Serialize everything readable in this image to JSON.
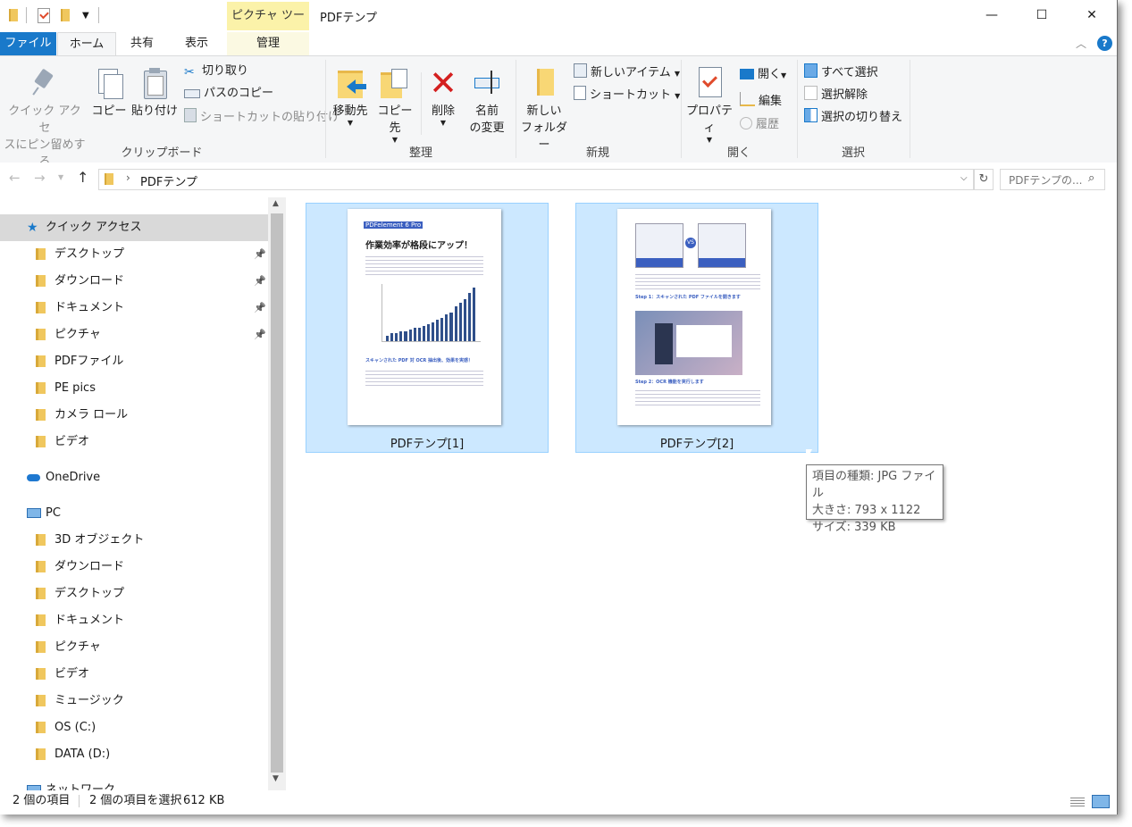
{
  "window": {
    "title": "PDFテンプ",
    "context_tab": "ピクチャ ツール",
    "minimize": "—",
    "maximize": "☐",
    "close": "✕"
  },
  "tabs": {
    "file": "ファイル",
    "home": "ホーム",
    "share": "共有",
    "view": "表示",
    "manage": "管理"
  },
  "ribbon": {
    "clipboard": {
      "label": "クリップボード",
      "pin_quick_line1": "クイック アクセ",
      "pin_quick_line2": "スにピン留めする",
      "copy": "コピー",
      "paste": "貼り付け",
      "cut": "切り取り",
      "copy_path": "パスのコピー",
      "paste_shortcut": "ショートカットの貼り付け"
    },
    "organize": {
      "label": "整理",
      "move_to": "移動先",
      "copy_to": "コピー先",
      "delete": "削除",
      "rename_line1": "名前",
      "rename_line2": "の変更"
    },
    "new": {
      "label": "新規",
      "new_folder_line1": "新しい",
      "new_folder_line2": "フォルダー",
      "new_item": "新しいアイテム",
      "shortcut": "ショートカット"
    },
    "open": {
      "label": "開く",
      "properties": "プロパティ",
      "open": "開く",
      "edit": "編集",
      "history": "履歴"
    },
    "select": {
      "label": "選択",
      "select_all": "すべて選択",
      "select_none": "選択解除",
      "invert": "選択の切り替え"
    }
  },
  "address": {
    "path": "PDFテンプ",
    "search_placeholder": "PDFテンプの..."
  },
  "nav": {
    "quick_access": "クイック アクセス",
    "quick_items": [
      "デスクトップ",
      "ダウンロード",
      "ドキュメント",
      "ピクチャ",
      "PDFファイル",
      "PE pics",
      "カメラ ロール",
      "ビデオ"
    ],
    "onedrive": "OneDrive",
    "pc": "PC",
    "pc_items": [
      "3D オブジェクト",
      "ダウンロード",
      "デスクトップ",
      "ドキュメント",
      "ピクチャ",
      "ビデオ",
      "ミュージック",
      "OS (C:)",
      "DATA (D:)"
    ],
    "network": "ネットワーク"
  },
  "files": [
    {
      "name": "PDFテンプ[1]",
      "thumb_header": "PDFelement 6 Pro",
      "thumb_title": "作業効率が格段にアップ！",
      "thumb_sub": "スキャンされた PDF 対 OCR 抽出後、効果を実感！"
    },
    {
      "name": "PDFテンプ[2]",
      "thumb_step1": "Step 1：スキャンされた PDF ファイルを開きます",
      "thumb_step2": "Step 2：OCR 機能を実行します"
    }
  ],
  "tooltip": {
    "type": "項目の種類: JPG ファイル",
    "size": "大きさ: 793 x 1122",
    "filesize": "サイズ: 339 KB"
  },
  "status": {
    "count": "2 個の項目",
    "selected": "2 個の項目を選択",
    "size": "612 KB"
  },
  "chart_bars": [
    3,
    4,
    4,
    5,
    5,
    6,
    7,
    7,
    8,
    9,
    10,
    11,
    12,
    14,
    15,
    18,
    20,
    22,
    25,
    28
  ]
}
